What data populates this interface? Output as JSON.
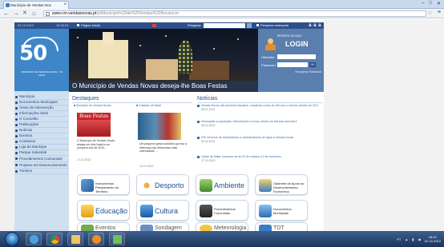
{
  "browser": {
    "tab_title": "Município de Vendas Nov",
    "tab_close": "×",
    "back": "←",
    "forward": "→",
    "reload": "✕",
    "home": "⌂",
    "url_host": "www.cm-vendasnovas.pt",
    "url_path": "/pt/Municipio%20de%20Vendas%20Novas/cm",
    "star": "☆",
    "menu": "≡",
    "win_min": "–",
    "win_max": "□",
    "win_close": "✕"
  },
  "site": {
    "topbar": {
      "date": "22.12.2012",
      "time": "16:23:24",
      "home_link": "Página Inicial",
      "search_label": "Pesquisa",
      "advanced_search": "Pesquisa avançada",
      "font_size": "a a a"
    },
    "logo": {
      "number": "50",
      "subtitle": "MUNICÍPIO DE VENDAS NOVAS · 50 ANOS"
    },
    "menu": [
      "Município",
      "Documentos Municipais",
      "Áreas de Intervenção",
      "Informações Úteis",
      "O Concelho",
      "Publicações",
      "Notícias",
      "Eventos",
      "Contactos",
      "Loja do Munícipe",
      "Parque Industrial",
      "Procedimentos Concursais",
      "Projetos em Desenvolvimento",
      "Turismo"
    ],
    "banner_title": "O Município de Vendas Novas deseja-lhe Boas Festas",
    "login": {
      "register": "REGISTE-SE AQUI",
      "title": "LOGIN",
      "user_label": "Utilizador",
      "pass_label": "Password",
      "ok": "OK",
      "recover": "Recuperar Password"
    },
    "destaques": {
      "title": "Destaques",
      "items": [
        {
          "link": "Município de Vendas Novas",
          "image_text": "Boas Festas",
          "text": "O Município de Vendas Novas deseja um feliz Natal e um próspero ano de 2013...",
          "date": "17.12.2012"
        },
        {
          "link": "Cabazes de Natal",
          "text": "Um pequeno gesto solidário que faz a diferença nas referendas mais carenciadas ...",
          "date": "10.12.2012"
        }
      ]
    },
    "noticias": {
      "title": "Notícias",
      "items": [
        {
          "title": "Vendas Novas não aumenta impostos, mantendo a taxa do IMI com o mesmo valores de 2011",
          "date": "05.11.2012"
        },
        {
          "title": "Informação à população: Intervenções no troço urbano da estrada nacional 4",
          "date": "09.11.2012"
        },
        {
          "title": "220 mil euros de investimento no abastecimento de água a Vendas Novas",
          "date": "02.11.2012"
        },
        {
          "title": "Cabaz de Natal: Inscrever-se de 22 de outubro a 2 de novembro",
          "date": "17.10.2012"
        }
      ]
    },
    "quick": {
      "instrumentos": "Instrumentos Planeamento do Território",
      "desporto": "Desporto",
      "ambiente": "Ambiente",
      "gabinete": "Gabinete de Apoio ao Desenvolvimento Económico",
      "educacao": "Educação",
      "cultura": "Cultura",
      "procedimentos": "Procedimentos Concursais",
      "documentos": "Documentos Municipais",
      "eventos": "Eventos",
      "sondagem": "Sondagem",
      "meteorologia": "Meteorologia",
      "tdt": "TDT"
    }
  },
  "taskbar": {
    "lang": "PT",
    "time": "16:23",
    "date": "22-12-2012"
  },
  "colors": {
    "site_blue": "#2f4f8a",
    "logo_blue": "#3f86c8",
    "login_panel": "#5a7fae"
  }
}
